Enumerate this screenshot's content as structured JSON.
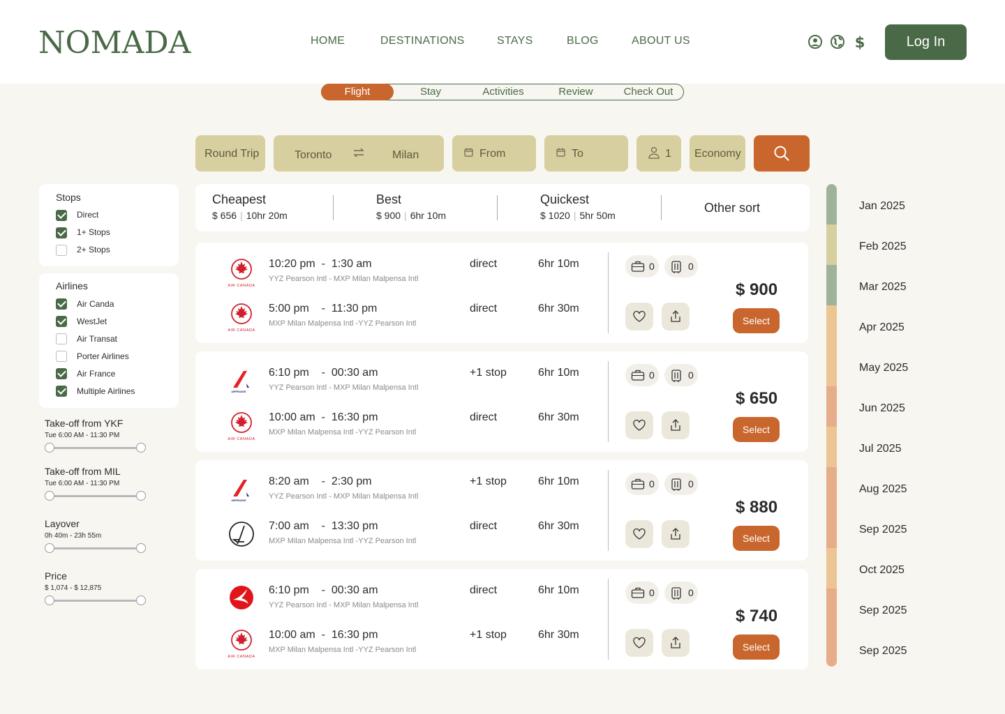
{
  "header": {
    "logo": "NOMADA",
    "nav": [
      "HOME",
      "DESTINATIONS",
      "STAYS",
      "BLOG",
      "ABOUT US"
    ],
    "login": "Log In"
  },
  "steps": [
    "Flight",
    "Stay",
    "Activities",
    "Review",
    "Check Out"
  ],
  "search": {
    "trip": "Round Trip",
    "from_city": "Toronto",
    "to_city": "Milan",
    "from": "From",
    "to": "To",
    "pax": "1",
    "cabin": "Economy"
  },
  "filters": {
    "stops": {
      "title": "Stops",
      "items": [
        {
          "label": "Direct",
          "checked": true
        },
        {
          "label": "1+ Stops",
          "checked": true
        },
        {
          "label": "2+ Stops",
          "checked": false
        }
      ]
    },
    "airlines": {
      "title": "Airlines",
      "items": [
        {
          "label": "Air Canda",
          "checked": true
        },
        {
          "label": "WestJet",
          "checked": true
        },
        {
          "label": "Air Transat",
          "checked": false
        },
        {
          "label": "Porter Airlines",
          "checked": false
        },
        {
          "label": "Air France",
          "checked": true
        },
        {
          "label": "Multiple Airlines",
          "checked": true
        }
      ]
    },
    "ranges": [
      {
        "title": "Take-off from YKF",
        "sub": "Tue 6:00 AM - 11:30 PM"
      },
      {
        "title": "Take-off from MIL",
        "sub": "Tue 6:00 AM - 11:30 PM"
      },
      {
        "title": "Layover",
        "sub": "0h 40m - 23h 55m"
      },
      {
        "title": "Price",
        "sub": "$ 1,074 - $ 12,875"
      }
    ]
  },
  "sort": [
    {
      "label": "Cheapest",
      "price": "$ 656",
      "dur": "10hr 20m"
    },
    {
      "label": "Best",
      "price": "$ 900",
      "dur": "6hr 10m"
    },
    {
      "label": "Quickest",
      "price": "$ 1020",
      "dur": "5hr 50m"
    },
    {
      "label": "Other sort"
    }
  ],
  "flights": [
    {
      "price": "$ 900",
      "select": "Select",
      "bag": "0",
      "carry": "0",
      "legs": [
        {
          "airline": "aircanada",
          "airline_text": "AIR CANADA",
          "time": "10:20 pm  -  1:30 am",
          "route": "YYZ Pearson Intl - MXP Milan Malpensa Intl",
          "stops": "direct",
          "dur": "6hr 10m"
        },
        {
          "airline": "aircanada",
          "airline_text": "AIR CANADA",
          "time": "5:00 pm    -  11:30 pm",
          "route": "MXP Milan Malpensa Intl -YYZ Pearson Intl",
          "stops": "direct",
          "dur": "6hr 30m"
        }
      ]
    },
    {
      "price": "$ 650",
      "select": "Select",
      "bag": "0",
      "carry": "0",
      "legs": [
        {
          "airline": "airfrance",
          "airline_text": "AIRFRANCE",
          "time": "6:10 pm    -  00:30 am",
          "route": "YYZ Pearson Intl - MXP Milan Malpensa Intl",
          "stops": "+1 stop",
          "dur": "6hr 10m"
        },
        {
          "airline": "aircanada",
          "airline_text": "AIR CANADA",
          "time": "10:00 am  -  16:30 pm",
          "route": "MXP Milan Malpensa Intl -YYZ Pearson Intl",
          "stops": "direct",
          "dur": "6hr 30m"
        }
      ]
    },
    {
      "price": "$ 880",
      "select": "Select",
      "bag": "0",
      "carry": "0",
      "legs": [
        {
          "airline": "airfrance",
          "airline_text": "AIRFRANCE",
          "time": "8:20 am    -  2:30 pm",
          "route": "YYZ Pearson Intl - MXP Milan Malpensa Intl",
          "stops": "+1 stop",
          "dur": "6hr 10m"
        },
        {
          "airline": "lufthansa",
          "airline_text": "",
          "time": "7:00 am    -  13:30 pm",
          "route": "MXP Milan Malpensa Intl -YYZ Pearson Intl",
          "stops": "direct",
          "dur": "6hr 30m"
        }
      ]
    },
    {
      "price": "$ 740",
      "select": "Select",
      "bag": "0",
      "carry": "0",
      "legs": [
        {
          "airline": "turkish",
          "airline_text": "",
          "time": "6:10 pm    -  00:30 am",
          "route": "YYZ Pearson Intl - MXP Milan Malpensa Intl",
          "stops": "direct",
          "dur": "6hr 10m"
        },
        {
          "airline": "aircanada",
          "airline_text": "AIR CANADA",
          "time": "10:00 am  -  16:30 pm",
          "route": "MXP Milan Malpensa Intl -YYZ Pearson Intl",
          "stops": "+1 stop",
          "dur": "6hr 30m"
        }
      ]
    }
  ],
  "months": [
    {
      "label": "Jan 2025",
      "color": "#9fb39a"
    },
    {
      "label": "Feb 2025",
      "color": "#d6cfa0"
    },
    {
      "label": "Mar 2025",
      "color": "#9fb39a"
    },
    {
      "label": "Apr 2025",
      "color": "#edc592"
    },
    {
      "label": "May 2025",
      "color": "#edc592"
    },
    {
      "label": "Jun 2025",
      "color": "#e5ad8a"
    },
    {
      "label": "Jul 2025",
      "color": "#edc592"
    },
    {
      "label": "Aug 2025",
      "color": "#e5ad8a"
    },
    {
      "label": "Sep 2025",
      "color": "#e5ad8a"
    },
    {
      "label": "Oct 2025",
      "color": "#edc592"
    },
    {
      "label": "Sep 2025",
      "color": "#e5ad8a"
    },
    {
      "label": "Sep 2025",
      "color": "#e5ad8a"
    }
  ]
}
